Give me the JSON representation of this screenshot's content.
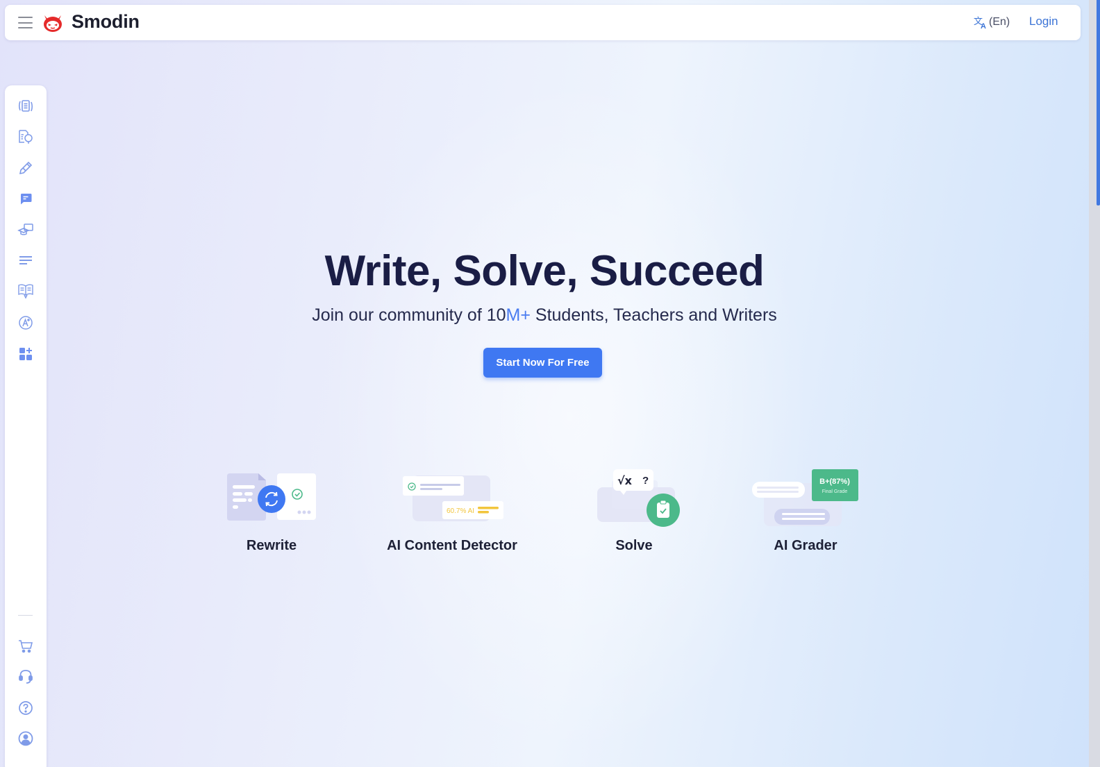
{
  "header": {
    "menu_icon": "hamburger-menu-icon",
    "logo_icon": "smodin-robot-logo",
    "brand": "Smodin",
    "language_icon": "translate-icon",
    "language": "(En)",
    "login": "Login"
  },
  "sidebar": {
    "items": [
      {
        "name": "rewriter",
        "icon": "rewrite-document-icon"
      },
      {
        "name": "plagiarism-checker",
        "icon": "document-search-icon"
      },
      {
        "name": "writer",
        "icon": "pencil-icon"
      },
      {
        "name": "chat",
        "icon": "chat-bubble-icon"
      },
      {
        "name": "homework-solver",
        "icon": "graduation-cap-icon"
      },
      {
        "name": "summarizer",
        "icon": "text-lines-icon"
      },
      {
        "name": "study",
        "icon": "open-book-icon"
      },
      {
        "name": "grader",
        "icon": "a-plus-icon"
      },
      {
        "name": "more-apps",
        "icon": "apps-add-icon"
      }
    ],
    "bottom_items": [
      {
        "name": "pricing",
        "icon": "cart-icon"
      },
      {
        "name": "support",
        "icon": "headset-icon"
      },
      {
        "name": "help",
        "icon": "help-circle-icon"
      },
      {
        "name": "account",
        "icon": "user-circle-icon"
      }
    ]
  },
  "hero": {
    "title": "Write, Solve, Succeed",
    "subtitle_prefix": "Join our community of 10",
    "subtitle_accent": "M+",
    "subtitle_suffix": " Students, Teachers and Writers",
    "cta": "Start Now For Free"
  },
  "features": [
    {
      "label": "Rewrite"
    },
    {
      "label": "AI Content Detector",
      "badge": "60.7% AI"
    },
    {
      "label": "Solve",
      "formula": "√x",
      "question": "?"
    },
    {
      "label": "AI Grader",
      "grade": "B+(87%)",
      "grade_caption": "Final Grade"
    }
  ],
  "colors": {
    "accent": "#3f78f2",
    "icon": "#7f9be8",
    "brand_red": "#e52a2a",
    "success_green": "#4cb98a",
    "warning_yellow": "#f2c53d",
    "title": "#1a1d45"
  }
}
